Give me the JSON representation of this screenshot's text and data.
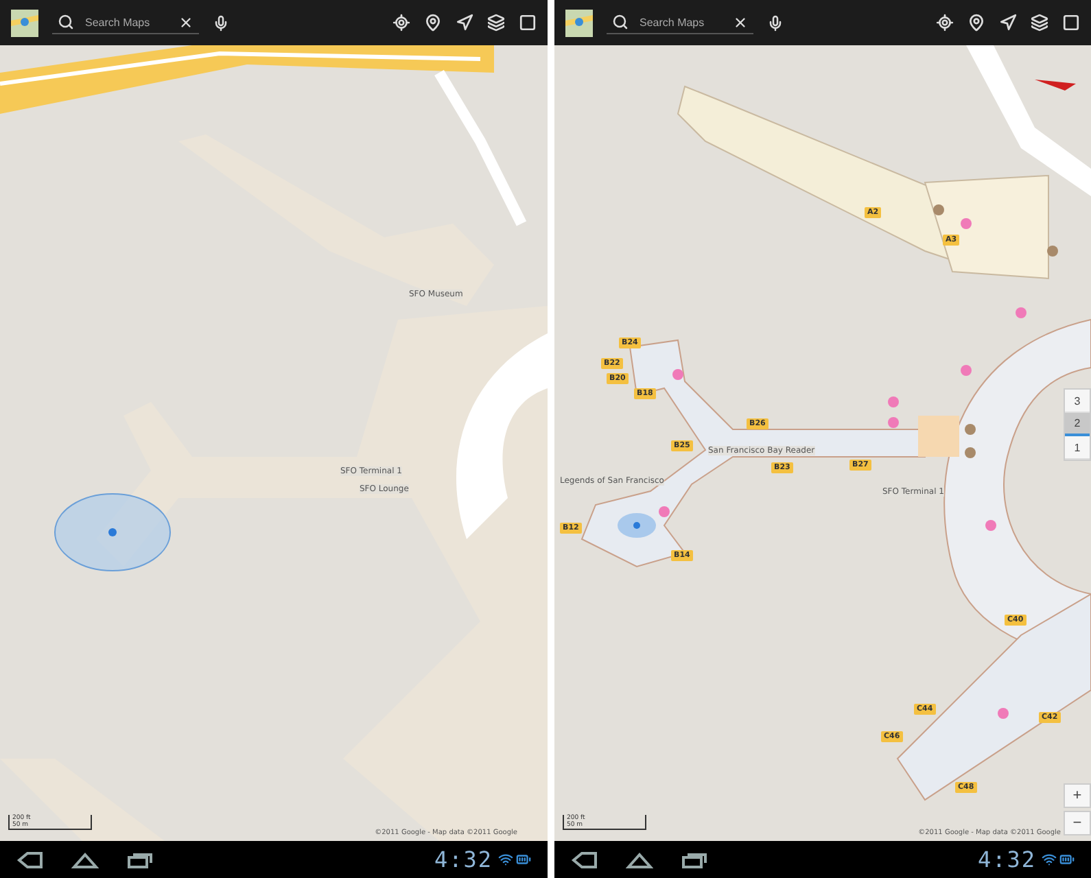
{
  "panels": [
    {
      "kind": "overview",
      "search": {
        "placeholder": "Search Maps"
      },
      "labels": [
        "SFO Museum",
        "SFO Terminal 1",
        "SFO Lounge"
      ],
      "scale": {
        "imperial": "200 ft",
        "metric": "50 m"
      },
      "copyright": "©2011 Google - Map data ©2011 Google",
      "clock": "4:32"
    },
    {
      "kind": "indoor",
      "search": {
        "placeholder": "Search Maps"
      },
      "labels": [
        "San Francisco Bay Reader",
        "Legends of San Francisco",
        "SFO Terminal 1"
      ],
      "gates": [
        "A2",
        "A3",
        "B24",
        "B22",
        "B20",
        "B18",
        "B26",
        "B25",
        "B23",
        "B27",
        "B12",
        "B14",
        "C40",
        "C44",
        "C46",
        "C42",
        "C48"
      ],
      "floors": [
        {
          "label": "3",
          "selected": false
        },
        {
          "label": "2",
          "selected": true
        },
        {
          "label": "1",
          "selected": false
        }
      ],
      "zoom": [
        "+",
        "−"
      ],
      "scale": {
        "imperial": "200 ft",
        "metric": "50 m"
      },
      "copyright": "©2011 Google - Map data ©2011 Google",
      "clock": "4:32"
    }
  ]
}
